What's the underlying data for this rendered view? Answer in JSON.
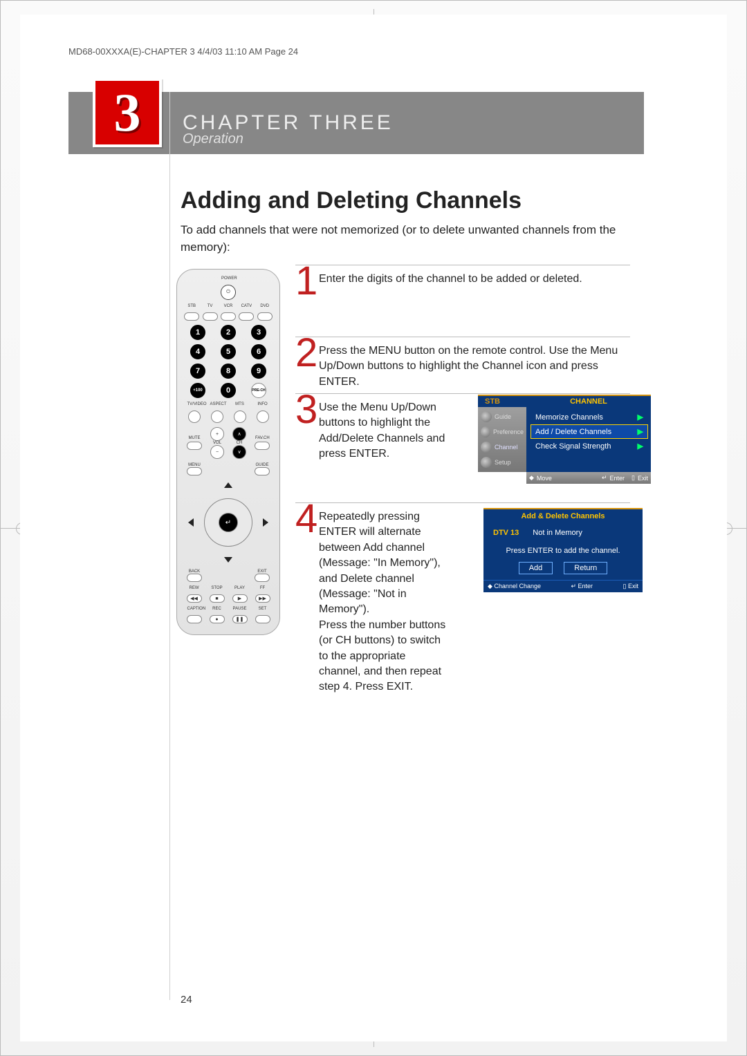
{
  "slug": "MD68-00XXXA(E)-CHAPTER 3  4/4/03  11:10 AM  Page 24",
  "chapter": {
    "num": "3",
    "title": "CHAPTER THREE",
    "subtitle": "Operation"
  },
  "section_title": "Adding and Deleting Channels",
  "intro": "To add channels that were not memorized (or to delete unwanted channels from the memory):",
  "page_number": "24",
  "steps": [
    {
      "n": "1",
      "text": "Enter the digits of the channel to be added or deleted."
    },
    {
      "n": "2",
      "text": "Press the MENU button on the remote control. Use the Menu Up/Down buttons to highlight the Channel icon and press ENTER."
    },
    {
      "n": "3",
      "text": "Use the Menu Up/Down buttons to highlight the Add/Delete Channels and press ENTER."
    },
    {
      "n": "4",
      "text": "Repeatedly pressing ENTER will alternate between  Add channel (Message: \"In Memory\"), and Delete channel (Message: \"Not in Memory\").\nPress the number buttons (or CH         buttons) to switch to the appropriate channel, and then repeat step 4. Press EXIT."
    }
  ],
  "osd": {
    "stb": "STB",
    "heading": "CHANNEL",
    "side_items": [
      "Guide",
      "Preference",
      "Channel",
      "Setup"
    ],
    "items": [
      "Memorize Channels",
      "Add / Delete Channels",
      "Check Signal Strength"
    ],
    "footer": {
      "move": "Move",
      "enter": "Enter",
      "exit": "Exit"
    }
  },
  "dlg": {
    "title": "Add & Delete Channels",
    "dtv": "DTV  13",
    "status": "Not in Memory",
    "prompt": "Press ENTER to add the channel.",
    "add": "Add",
    "return": "Return",
    "foot": {
      "chchange": "Channel Change",
      "enter": "Enter",
      "exit": "Exit"
    }
  },
  "remote": {
    "power": "POWER",
    "mode_labels": [
      "STB",
      "TV",
      "VCR",
      "CATV",
      "DVD"
    ],
    "numbers": [
      "1",
      "2",
      "3",
      "4",
      "5",
      "6",
      "7",
      "8",
      "9",
      "+100",
      "0"
    ],
    "prech": "PRE-CH",
    "row_labels_1": [
      "TV/VIDEO",
      "ASPECT",
      "MTS",
      "INFO"
    ],
    "mute": "MUTE",
    "favch": "FAV.CH",
    "vol": "VOL",
    "ch": "CH",
    "menu": "MENU",
    "guide": "GUIDE",
    "back": "BACK",
    "exit": "EXIT",
    "transport_labels": [
      "REW",
      "STOP",
      "PLAY",
      "FF"
    ],
    "transport_syms": [
      "◀◀",
      "■",
      "▶",
      "▶▶"
    ],
    "bottom_labels": [
      "CAPTION",
      "REC",
      "PAUSE",
      "SET"
    ],
    "bottom_syms": [
      "",
      "●",
      "❚❚",
      ""
    ]
  }
}
